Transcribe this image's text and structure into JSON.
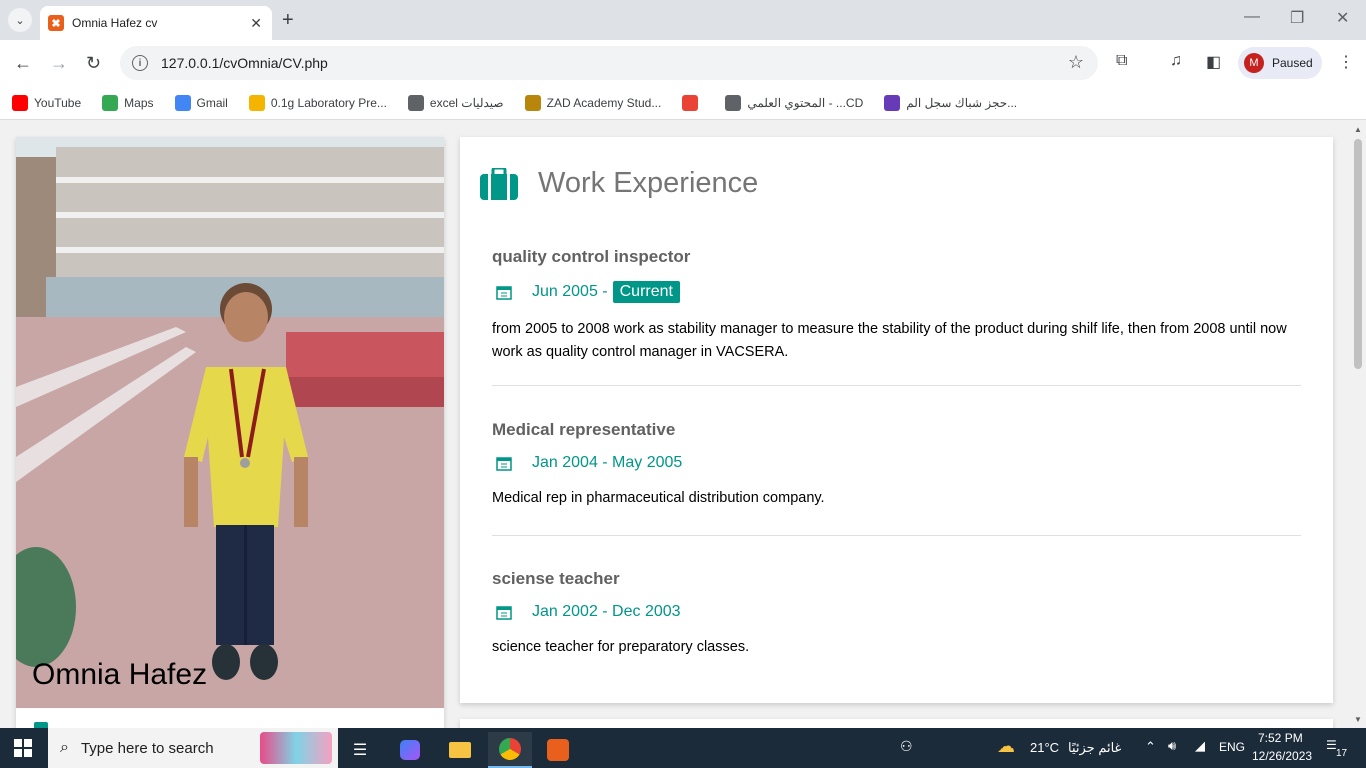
{
  "browser": {
    "tab_title": "Omnia Hafez cv",
    "url": "127.0.0.1/cvOmnia/CV.php",
    "profile_initial": "M",
    "profile_status": "Paused"
  },
  "bookmarks": [
    {
      "label": "YouTube",
      "icon": "youtube-icon",
      "color": "#ff0000"
    },
    {
      "label": "Maps",
      "icon": "maps-icon",
      "color": "#34a853"
    },
    {
      "label": "Gmail",
      "icon": "google-icon",
      "color": "#4285f4"
    },
    {
      "label": "0.1g Laboratory Pre...",
      "icon": "site-icon",
      "color": "#f4b400"
    },
    {
      "label": "excel صيدليات",
      "icon": "globe-icon",
      "color": "#5f6368"
    },
    {
      "label": "ZAD Academy Stud...",
      "icon": "zad-icon",
      "color": "#b8860b"
    },
    {
      "label": "",
      "icon": "gmail-icon",
      "color": "#ea4335"
    },
    {
      "label": "المحتوي العلمي - ...CD",
      "icon": "globe-icon",
      "color": "#5f6368"
    },
    {
      "label": "حجز شباك سجل الم...",
      "icon": "forms-icon",
      "color": "#673ab7"
    }
  ],
  "profile": {
    "name": "Omnia Hafez"
  },
  "work": {
    "section_title": "Work Experience",
    "jobs": [
      {
        "title": "quality control inspector",
        "date": "Jun 2005 -",
        "badge": "Current",
        "description": "from 2005 to 2008 work as stability manager to measure the stability of the product during shilf life, then from 2008 until now work as quality control manager in VACSERA."
      },
      {
        "title": "Medical representative",
        "date": "Jan 2004 - May 2005",
        "badge": "",
        "description": "Medical rep in pharmaceutical distribution company."
      },
      {
        "title": "sciense teacher",
        "date": "Jan 2002 - Dec 2003",
        "badge": "",
        "description": "science teacher for preparatory classes."
      }
    ]
  },
  "taskbar": {
    "search_placeholder": "Type here to search",
    "weather_temp": "21°C",
    "weather_desc": "غائم جزئيًا",
    "language": "ENG",
    "time": "7:52 PM",
    "date": "12/26/2023",
    "notification_count": "17"
  },
  "colors": {
    "accent": "#009688",
    "heading": "#757575"
  }
}
